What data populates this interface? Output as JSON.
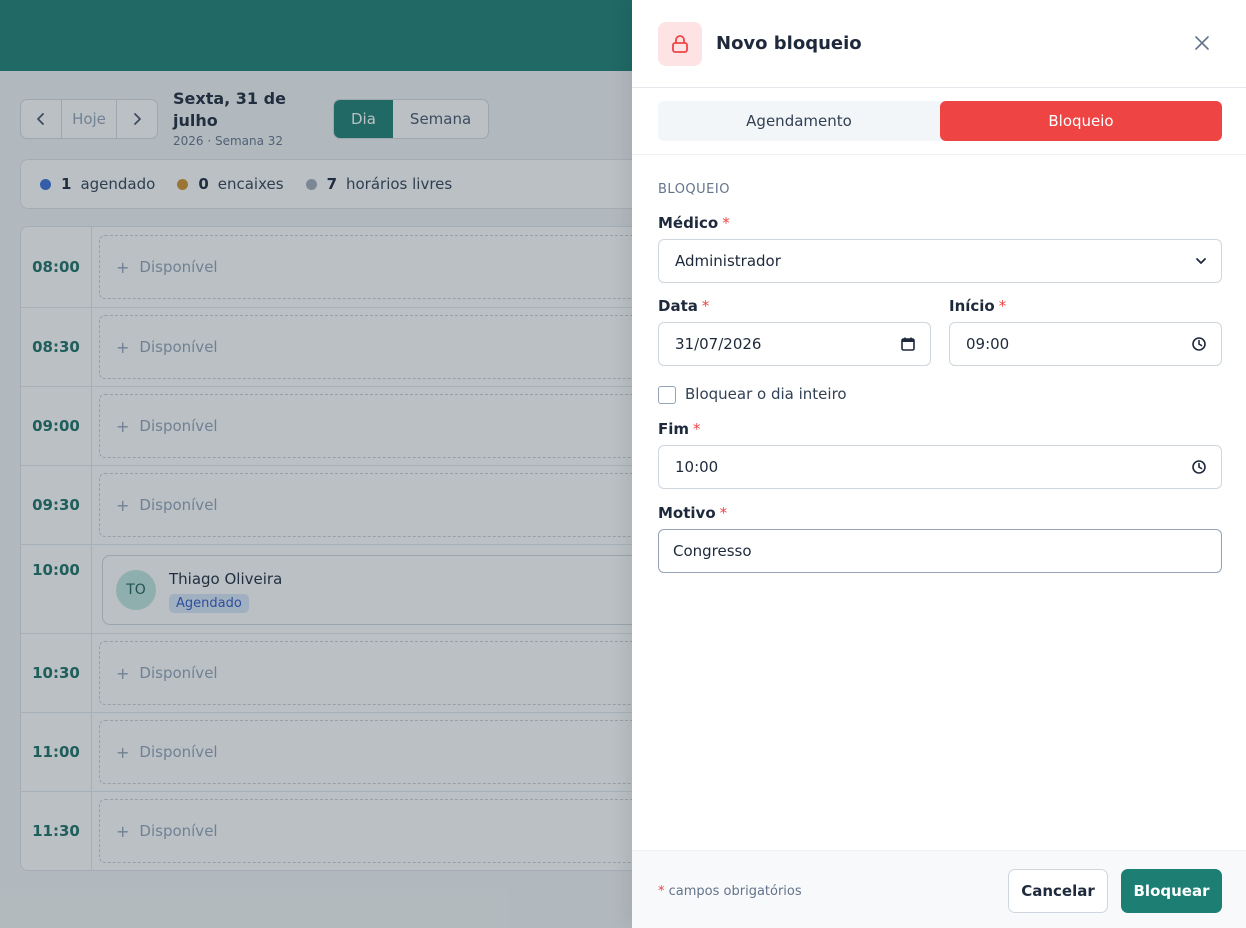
{
  "calendar": {
    "nav": {
      "today_label": "Hoje"
    },
    "date_title": "Sexta, 31 de julho",
    "date_subtitle": "2026 · Semana 32",
    "views": [
      {
        "label": "Dia",
        "active": true
      },
      {
        "label": "Semana",
        "active": false
      }
    ],
    "summary": [
      {
        "count": "1",
        "label": "agendado",
        "color": "#3b6fd6"
      },
      {
        "count": "0",
        "label": "encaixes",
        "color": "#d2932a"
      },
      {
        "count": "7",
        "label": "horários livres",
        "color": "#a3acb8"
      }
    ],
    "free_label": "Disponível",
    "slots": [
      {
        "time": "08:00"
      },
      {
        "time": "08:30"
      },
      {
        "time": "09:00"
      },
      {
        "time": "09:30"
      },
      {
        "time": "10:00",
        "appointment": {
          "initials": "TO",
          "name": "Thiago Oliveira",
          "status": "Agendado"
        }
      },
      {
        "time": "10:30"
      },
      {
        "time": "11:00"
      },
      {
        "time": "11:30"
      }
    ]
  },
  "drawer": {
    "title": "Novo bloqueio",
    "icon": "lock-icon",
    "tabs": [
      {
        "label": "Agendamento",
        "active": false
      },
      {
        "label": "Bloqueio",
        "active": true
      }
    ],
    "section_title": "BLOQUEIO",
    "required_marker": "*",
    "fields": {
      "medico": {
        "label": "Médico",
        "value": "Administrador"
      },
      "data": {
        "label": "Data",
        "value": "31/07/2026"
      },
      "inicio": {
        "label": "Início",
        "value": "09:00"
      },
      "dia_inteiro": {
        "label": "Bloquear o dia inteiro",
        "checked": false
      },
      "fim": {
        "label": "Fim",
        "value": "10:00"
      },
      "motivo": {
        "label": "Motivo",
        "value": "Congresso"
      }
    },
    "footer": {
      "note": "campos obrigatórios",
      "cancel_label": "Cancelar",
      "submit_label": "Bloquear"
    }
  },
  "colors": {
    "brand": "#1d7f74",
    "danger": "#ef4444"
  }
}
